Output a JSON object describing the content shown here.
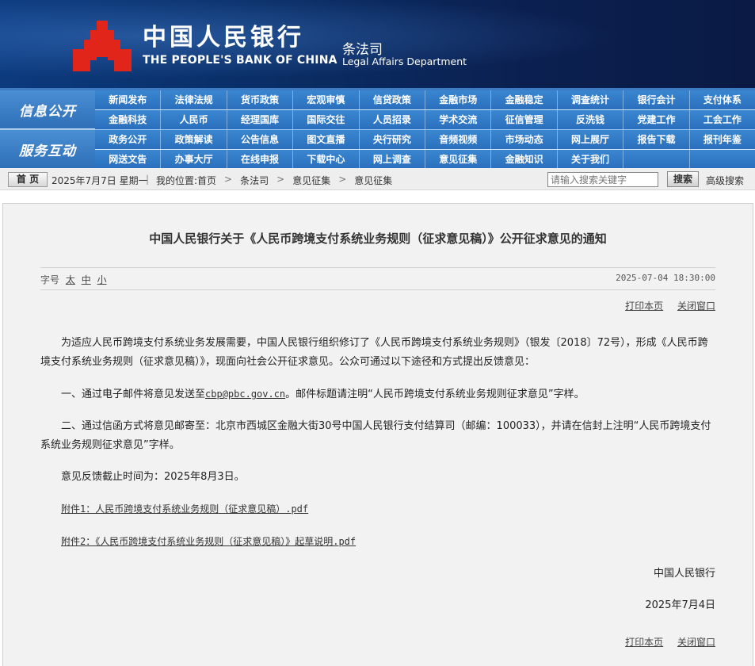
{
  "header": {
    "brand_cn": "中国人民银行",
    "brand_en": "THE PEOPLE'S BANK OF CHINA",
    "dept_cn": "条法司",
    "dept_en": "Legal Affairs Department",
    "logo_color": "#e1251b",
    "bg_color": "#0c2f6b"
  },
  "nav": {
    "sections": [
      {
        "label": "信息公开",
        "rows": [
          [
            "新闻发布",
            "法律法规",
            "货币政策",
            "宏观审慎",
            "信贷政策",
            "金融市场",
            "金融稳定",
            "调查统计",
            "银行会计",
            "支付体系"
          ],
          [
            "金融科技",
            "人民币",
            "经理国库",
            "国际交往",
            "人员招录",
            "学术交流",
            "征信管理",
            "反洗钱",
            "党建工作",
            "工会工作"
          ]
        ]
      },
      {
        "label": "服务互动",
        "rows": [
          [
            "政务公开",
            "政策解读",
            "公告信息",
            "图文直播",
            "央行研究",
            "音频视频",
            "市场动态",
            "网上展厅",
            "报告下载",
            "报刊年鉴"
          ],
          [
            "网送文告",
            "办事大厅",
            "在线申报",
            "下载中心",
            "网上调查",
            "意见征集",
            "金融知识",
            "关于我们",
            "",
            ""
          ]
        ]
      }
    ]
  },
  "crumbbar": {
    "home": "首 页",
    "date": "2025年7月7日 星期一",
    "location_label": "我的位置:首页",
    "crumbs": [
      "条法司",
      "意见征集",
      "意见征集"
    ],
    "search_placeholder": "请输入搜索关键字",
    "search_button": "搜索",
    "advanced_search": "高级搜索"
  },
  "article": {
    "title": "中国人民银行关于《人民币跨境支付系统业务规则（征求意见稿）》公开征求意见的通知",
    "font_size_label": "字号",
    "font_sizes": [
      "太",
      "中",
      "小"
    ],
    "pub_time": "2025-07-04 18:30:00",
    "print_label": "打印本页",
    "close_label": "关闭窗口",
    "para1": "为适应人民币跨境支付系统业务发展需要，中国人民银行组织修订了《人民币跨境支付系统业务规则》（银发〔2018〕72号），形成《人民币跨境支付系统业务规则（征求意见稿）》，现面向社会公开征求意见。公众可通过以下途径和方式提出反馈意见：",
    "para2_prefix": "一、通过电子邮件将意见发送至",
    "para2_email": "cbp@pbc.gov.cn",
    "para2_suffix": "。邮件标题请注明“人民币跨境支付系统业务规则征求意见”字样。",
    "para3": "二、通过信函方式将意见邮寄至：北京市西城区金融大街30号中国人民银行支付结算司（邮编：100033），并请在信封上注明“人民币跨境支付系统业务规则征求意见”字样。",
    "para4": "意见反馈截止时间为：2025年8月3日。",
    "attachment1": "附件1：人民币跨境支付系统业务规则（征求意见稿）.pdf",
    "attachment2": "附件2：《人民币跨境支付系统业务规则（征求意见稿）》起草说明.pdf",
    "signature": "中国人民银行",
    "sign_date": "2025年7月4日"
  }
}
